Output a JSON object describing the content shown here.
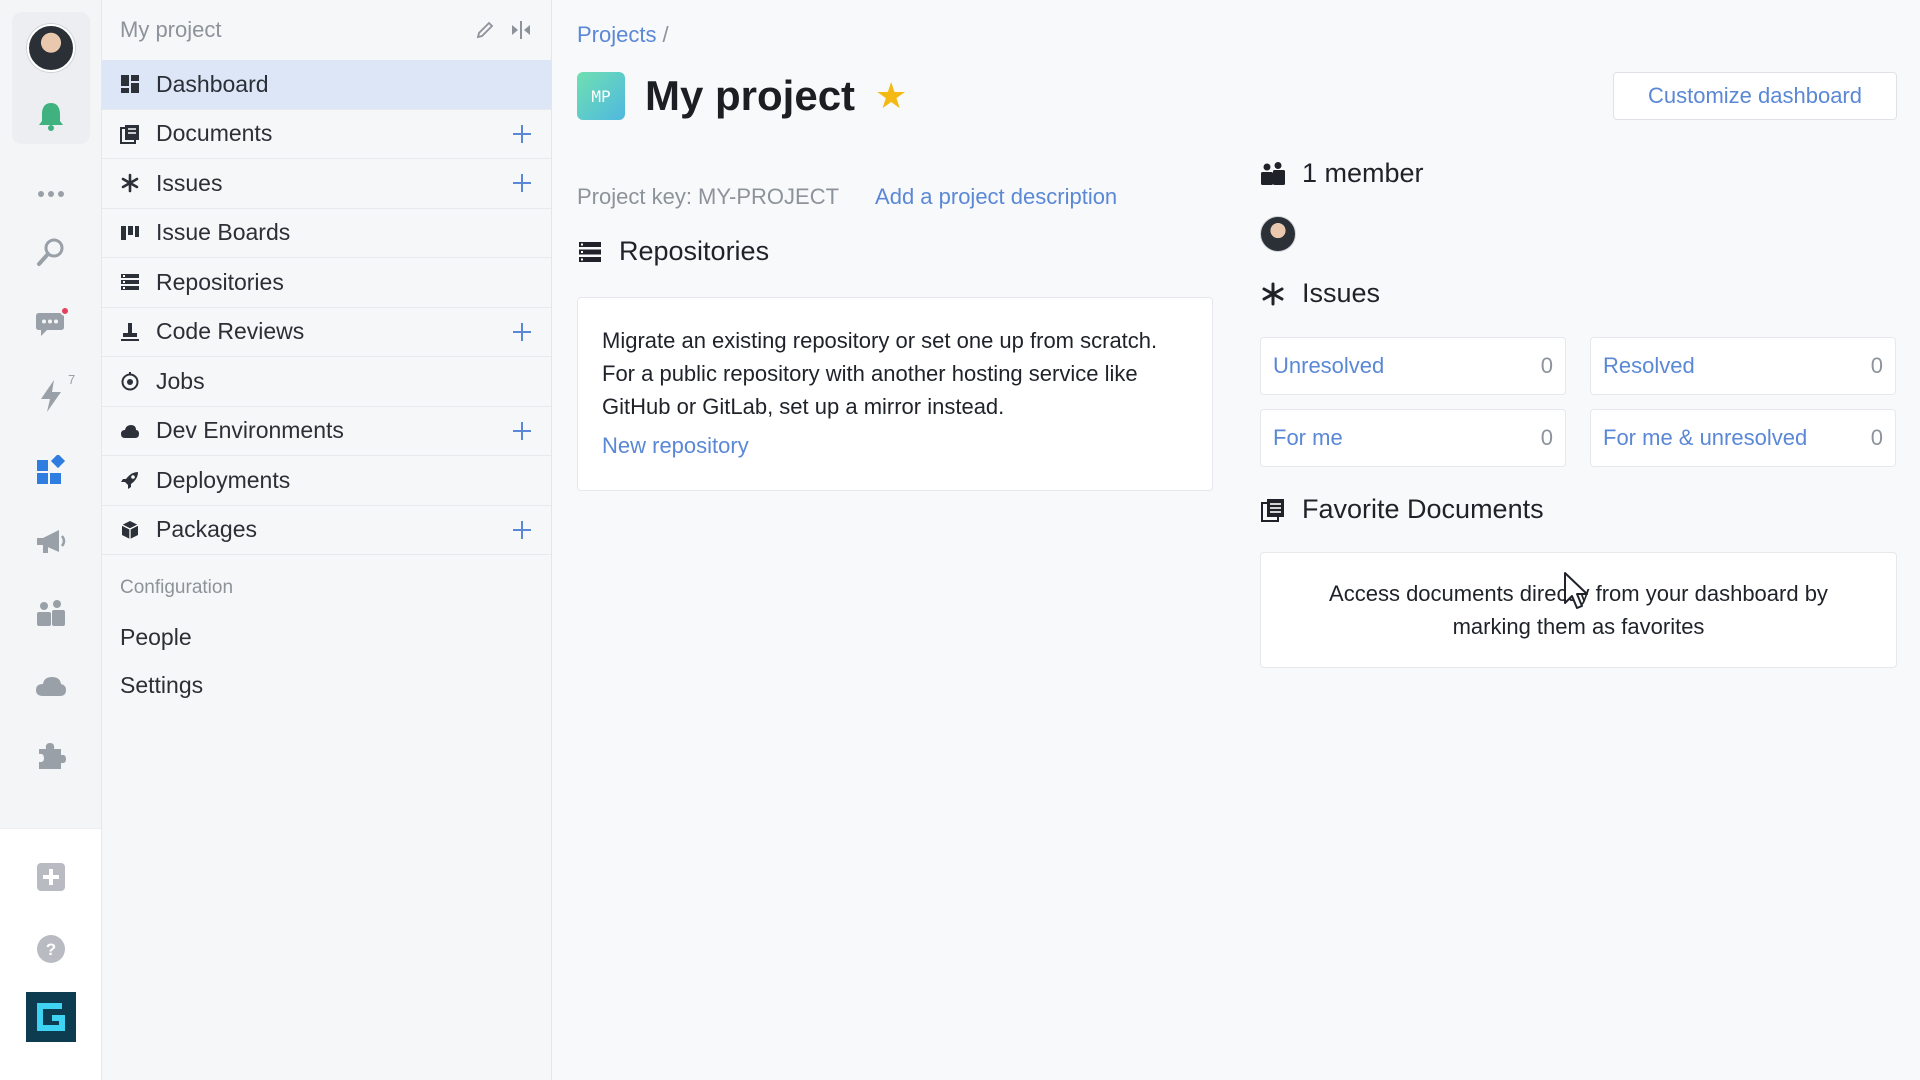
{
  "rail": {
    "items": [
      {
        "name": "avatar"
      },
      {
        "name": "bell-icon"
      },
      {
        "name": "more-icon"
      },
      {
        "name": "search-icon"
      },
      {
        "name": "chat-icon"
      },
      {
        "name": "lightning-icon",
        "count": "7"
      },
      {
        "name": "apps-icon"
      },
      {
        "name": "megaphone-icon"
      },
      {
        "name": "team-icon"
      },
      {
        "name": "cloud-icon"
      },
      {
        "name": "puzzle-icon"
      },
      {
        "name": "add-icon"
      },
      {
        "name": "help-icon"
      },
      {
        "name": "logo-icon"
      }
    ],
    "accent": "#2f7de1",
    "notification_color": "#3fb27f"
  },
  "sidebar": {
    "title": "My project",
    "items": [
      {
        "label": "Dashboard",
        "icon": "dashboard-icon",
        "active": true,
        "plus": false
      },
      {
        "label": "Documents",
        "icon": "documents-icon",
        "active": false,
        "plus": true
      },
      {
        "label": "Issues",
        "icon": "asterisk-icon",
        "active": false,
        "plus": true
      },
      {
        "label": "Issue Boards",
        "icon": "board-icon",
        "active": false,
        "plus": false
      },
      {
        "label": "Repositories",
        "icon": "repository-icon",
        "active": false,
        "plus": false
      },
      {
        "label": "Code Reviews",
        "icon": "code-review-icon",
        "active": false,
        "plus": true
      },
      {
        "label": "Jobs",
        "icon": "jobs-icon",
        "active": false,
        "plus": false
      },
      {
        "label": "Dev Environments",
        "icon": "cloud-icon",
        "active": false,
        "plus": true
      },
      {
        "label": "Deployments",
        "icon": "rocket-icon",
        "active": false,
        "plus": false
      },
      {
        "label": "Packages",
        "icon": "package-icon",
        "active": false,
        "plus": true
      }
    ],
    "config_section": "Configuration",
    "config_links": [
      "People",
      "Settings"
    ]
  },
  "main": {
    "breadcrumb": "Projects",
    "breadcrumb_sep": "/",
    "logo_text": "MP",
    "title": "My project",
    "customize_label": "Customize dashboard",
    "project_key": "Project key: MY-PROJECT",
    "add_description": "Add a project description",
    "repositories": {
      "title": "Repositories",
      "description": "Migrate an existing repository or set one up from scratch. For a public repository with another hosting service like GitHub or GitLab, set up a mirror instead.",
      "new_link": "New repository"
    },
    "members": {
      "title": "1 member"
    },
    "issues": {
      "title": "Issues",
      "stats": [
        {
          "label": "Unresolved",
          "value": "0"
        },
        {
          "label": "Resolved",
          "value": "0"
        },
        {
          "label": "For me",
          "value": "0"
        },
        {
          "label": "For me & unresolved",
          "value": "0"
        }
      ]
    },
    "favorites": {
      "title": "Favorite Documents",
      "text": "Access documents directly from your dashboard by marking them as favorites"
    }
  }
}
